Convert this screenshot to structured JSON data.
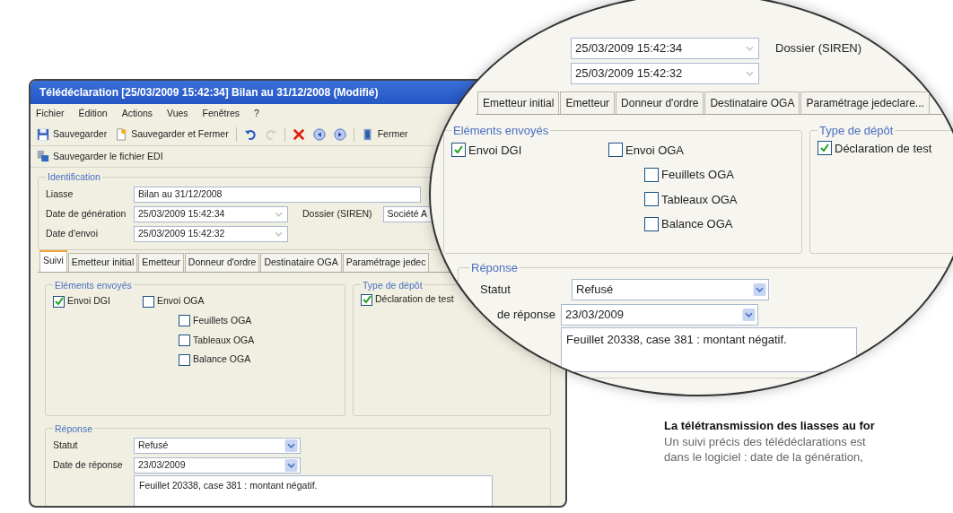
{
  "window": {
    "title": "Télédéclaration [25/03/2009 15:42:34] Bilan au 31/12/2008 (Modifié)",
    "menu": [
      "Fichier",
      "Édition",
      "Actions",
      "Vues",
      "Fenêtres",
      "?"
    ],
    "toolbar": [
      {
        "kind": "labeled",
        "label": "Sauvegarder",
        "disabled": false
      },
      {
        "kind": "labeled",
        "label": "Sauvegarder et Fermer",
        "disabled": false
      },
      {
        "kind": "icon",
        "disabled": false
      },
      {
        "kind": "icon",
        "disabled": true
      },
      {
        "kind": "icon",
        "disabled": false
      },
      {
        "kind": "icon",
        "disabled": false
      },
      {
        "kind": "icon",
        "disabled": false
      },
      {
        "kind": "labeled",
        "label": "Fermer",
        "disabled": false
      }
    ],
    "edi_button": "Sauvegarder le fichier EDI",
    "identification": {
      "title": "Identification",
      "liasse": {
        "label": "Liasse",
        "value": "Bilan au 31/12/2008"
      },
      "generation": {
        "label": "Date de génération",
        "value": "25/03/2009 15:42:34",
        "disabled": true
      },
      "dossier": {
        "label": "Dossier (SIREN)",
        "value": "Société A"
      },
      "envoi": {
        "label": "Date d'envoi",
        "value": "25/03/2009 15:42:32",
        "disabled": true
      }
    },
    "tabs": [
      {
        "label": "Suivi",
        "selected": true
      },
      {
        "label": "Emetteur initial",
        "selected": false
      },
      {
        "label": "Emetteur",
        "selected": false
      },
      {
        "label": "Donneur d'ordre",
        "selected": false
      },
      {
        "label": "Destinataire OGA",
        "selected": false
      },
      {
        "label": "Paramétrage jedec",
        "selected": false
      }
    ],
    "elements": {
      "title": "Eléments envoyés",
      "items": [
        {
          "label": "Envoi DGI",
          "checked": true
        },
        {
          "label": "Envoi OGA",
          "checked": false,
          "children": [
            {
              "label": "Feuillets OGA",
              "checked": false
            },
            {
              "label": "Tableaux OGA",
              "checked": false
            },
            {
              "label": "Balance OGA",
              "checked": false
            }
          ]
        }
      ]
    },
    "depot": {
      "title": "Type de dépôt",
      "items": [
        {
          "label": "Déclaration de test",
          "checked": true
        }
      ]
    },
    "reponse": {
      "title": "Réponse",
      "statut": {
        "label": "Statut",
        "value": "Refusé"
      },
      "date": {
        "label": "Date de réponse",
        "value": "23/03/2009"
      },
      "comment": "Feuillet 20338, case 381 : montant négatif."
    }
  },
  "magnifier": {
    "generation": {
      "value": "25/03/2009 15:42:34",
      "disabled": true
    },
    "dossier_label": "Dossier (SIREN)",
    "envoi": {
      "value": "25/03/2009 15:42:32",
      "disabled": true
    },
    "tabs": [
      {
        "label": "Emetteur initial",
        "selected": false
      },
      {
        "label": "Emetteur",
        "selected": false
      },
      {
        "label": "Donneur d'ordre",
        "selected": false
      },
      {
        "label": "Destinataire OGA",
        "selected": false
      },
      {
        "label": "Paramétrage jedeclare...",
        "selected": false
      }
    ],
    "elements": {
      "title": "Eléments envoyés",
      "items": [
        {
          "label": "Envoi DGI",
          "checked": true
        },
        {
          "label": "Envoi OGA",
          "checked": false,
          "children": [
            {
              "label": "Feuillets OGA",
              "checked": false
            },
            {
              "label": "Tableaux OGA",
              "checked": false
            },
            {
              "label": "Balance OGA",
              "checked": false
            }
          ]
        }
      ]
    },
    "depot": {
      "title": "Type de dépôt",
      "items": [
        {
          "label": "Déclaration de test",
          "checked": true
        }
      ]
    },
    "reponse": {
      "title": "Réponse",
      "statut": {
        "label": "Statut",
        "value": "Refusé"
      },
      "date": {
        "label": "de réponse",
        "value": "23/03/2009"
      },
      "comment": "Feuillet 20338, case 381 : montant négatif."
    }
  },
  "caption": {
    "heading": "La télétransmission des liasses au for",
    "lines": [
      "Un suivi précis des télédéclarations est",
      "dans le logiciel : date de la génération,"
    ]
  }
}
